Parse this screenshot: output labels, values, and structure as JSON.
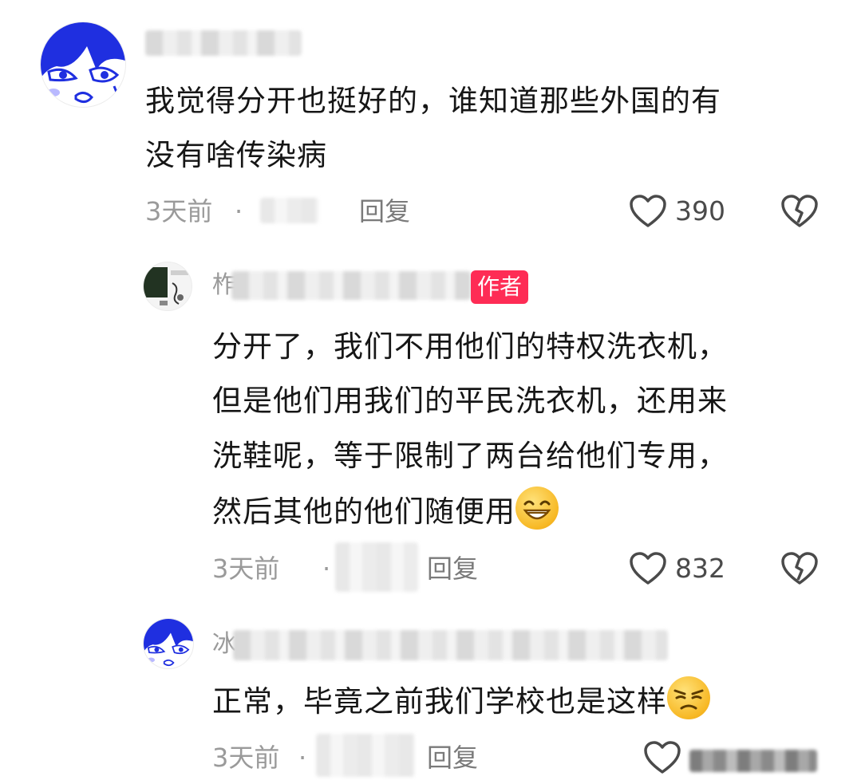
{
  "comments": [
    {
      "text_lines": [
        "我觉得分开也挺好的，谁知道那些外国的有",
        "没有啥传染病"
      ],
      "time": "3天前",
      "dot": "·",
      "reply": "回复",
      "likes": "390"
    },
    {
      "partial_name": "柞",
      "badge": "作者",
      "text_lines": [
        "分开了，我们不用他们的特权洗衣机，",
        "但是他们用我们的平民洗衣机，还用来",
        "洗鞋呢，等于限制了两台给他们专用，",
        "然后其他的他们随便用"
      ],
      "time": "3天前",
      "dot": "·",
      "reply": "回复",
      "likes": "832"
    },
    {
      "partial_name": "冰",
      "text_lines": [
        "正常，毕竟之前我们学校也是这样"
      ],
      "time": "3天前",
      "dot": "·",
      "reply": "回复"
    }
  ],
  "icons": {
    "like": "heart-outline-icon",
    "dislike": "broken-heart-icon",
    "emoji_1": "grin-emoji",
    "emoji_2": "unamused-emoji"
  },
  "colors": {
    "badge": "#fe2c55",
    "meta": "#9a9a9a",
    "text": "#161616"
  }
}
